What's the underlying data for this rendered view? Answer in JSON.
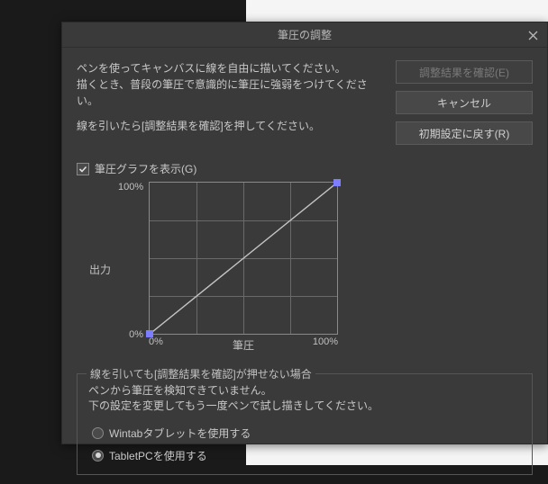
{
  "dialog": {
    "title": "筆圧の調整",
    "instructions_line1": "ペンを使ってキャンバスに線を自由に描いてください。",
    "instructions_line2": "描くとき、普段の筆圧で意識的に筆圧に強弱をつけてください。",
    "instructions_line3": "線を引いたら[調整結果を確認]を押してください。",
    "buttons": {
      "confirm": "調整結果を確認(E)",
      "cancel": "キャンセル",
      "reset": "初期設定に戻す(R)"
    },
    "checkbox_label": "筆圧グラフを表示(G)",
    "checkbox_checked": true
  },
  "chart_data": {
    "type": "line",
    "xlabel": "筆圧",
    "ylabel": "出力",
    "xlim": [
      0,
      100
    ],
    "ylim": [
      0,
      100
    ],
    "x": [
      0,
      100
    ],
    "values": [
      0,
      100
    ],
    "xticks": [
      "0%",
      "100%"
    ],
    "yticks": [
      "0%",
      "100%"
    ],
    "handles": [
      [
        0,
        0
      ],
      [
        100,
        100
      ]
    ]
  },
  "troubleshoot": {
    "legend": "線を引いても[調整結果を確認]が押せない場合",
    "warn_line1": "ペンから筆圧を検知できていません。",
    "warn_line2": "下の設定を変更してもう一度ペンで試し描きしてください。",
    "radio_wintab": "Wintabタブレットを使用する",
    "radio_tabletpc": "TabletPCを使用する",
    "selected": "tabletpc"
  }
}
